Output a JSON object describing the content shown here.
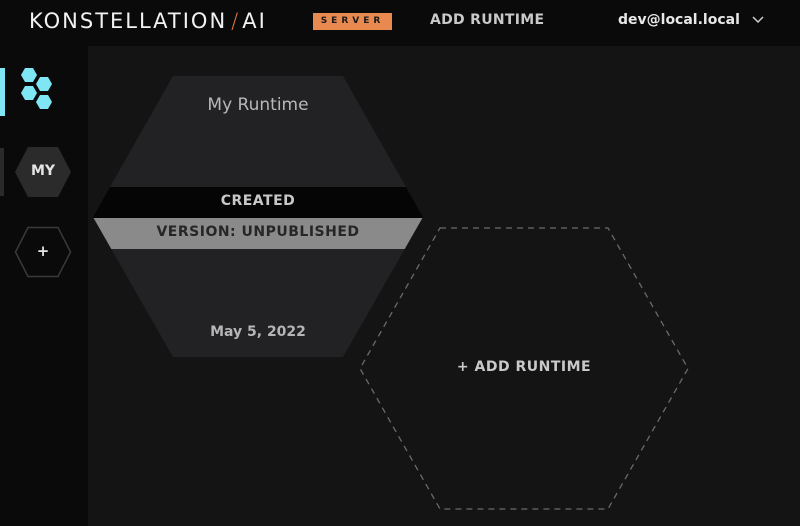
{
  "header": {
    "logo_text": "KONSTELLATION",
    "logo_slash": "/",
    "logo_suffix": "AI",
    "badge": "SERVER",
    "add_runtime": "ADD RUNTIME",
    "user_email": "dev@local.local"
  },
  "sidebar": {
    "items": [
      {
        "icon": "hexagon-cluster-icon"
      },
      {
        "label": "MY"
      },
      {
        "label": "+"
      }
    ]
  },
  "runtimes": [
    {
      "name": "My Runtime",
      "status": "CREATED",
      "version": "VERSION: UNPUBLISHED",
      "date": "May 5, 2022"
    }
  ],
  "add_card": {
    "label": "+ ADD RUNTIME"
  },
  "colors": {
    "accent_cyan": "#7fe7f3",
    "brand_orange": "#e8894f",
    "background": "#0a0a0a",
    "panel": "#141414",
    "card": "#222225"
  }
}
